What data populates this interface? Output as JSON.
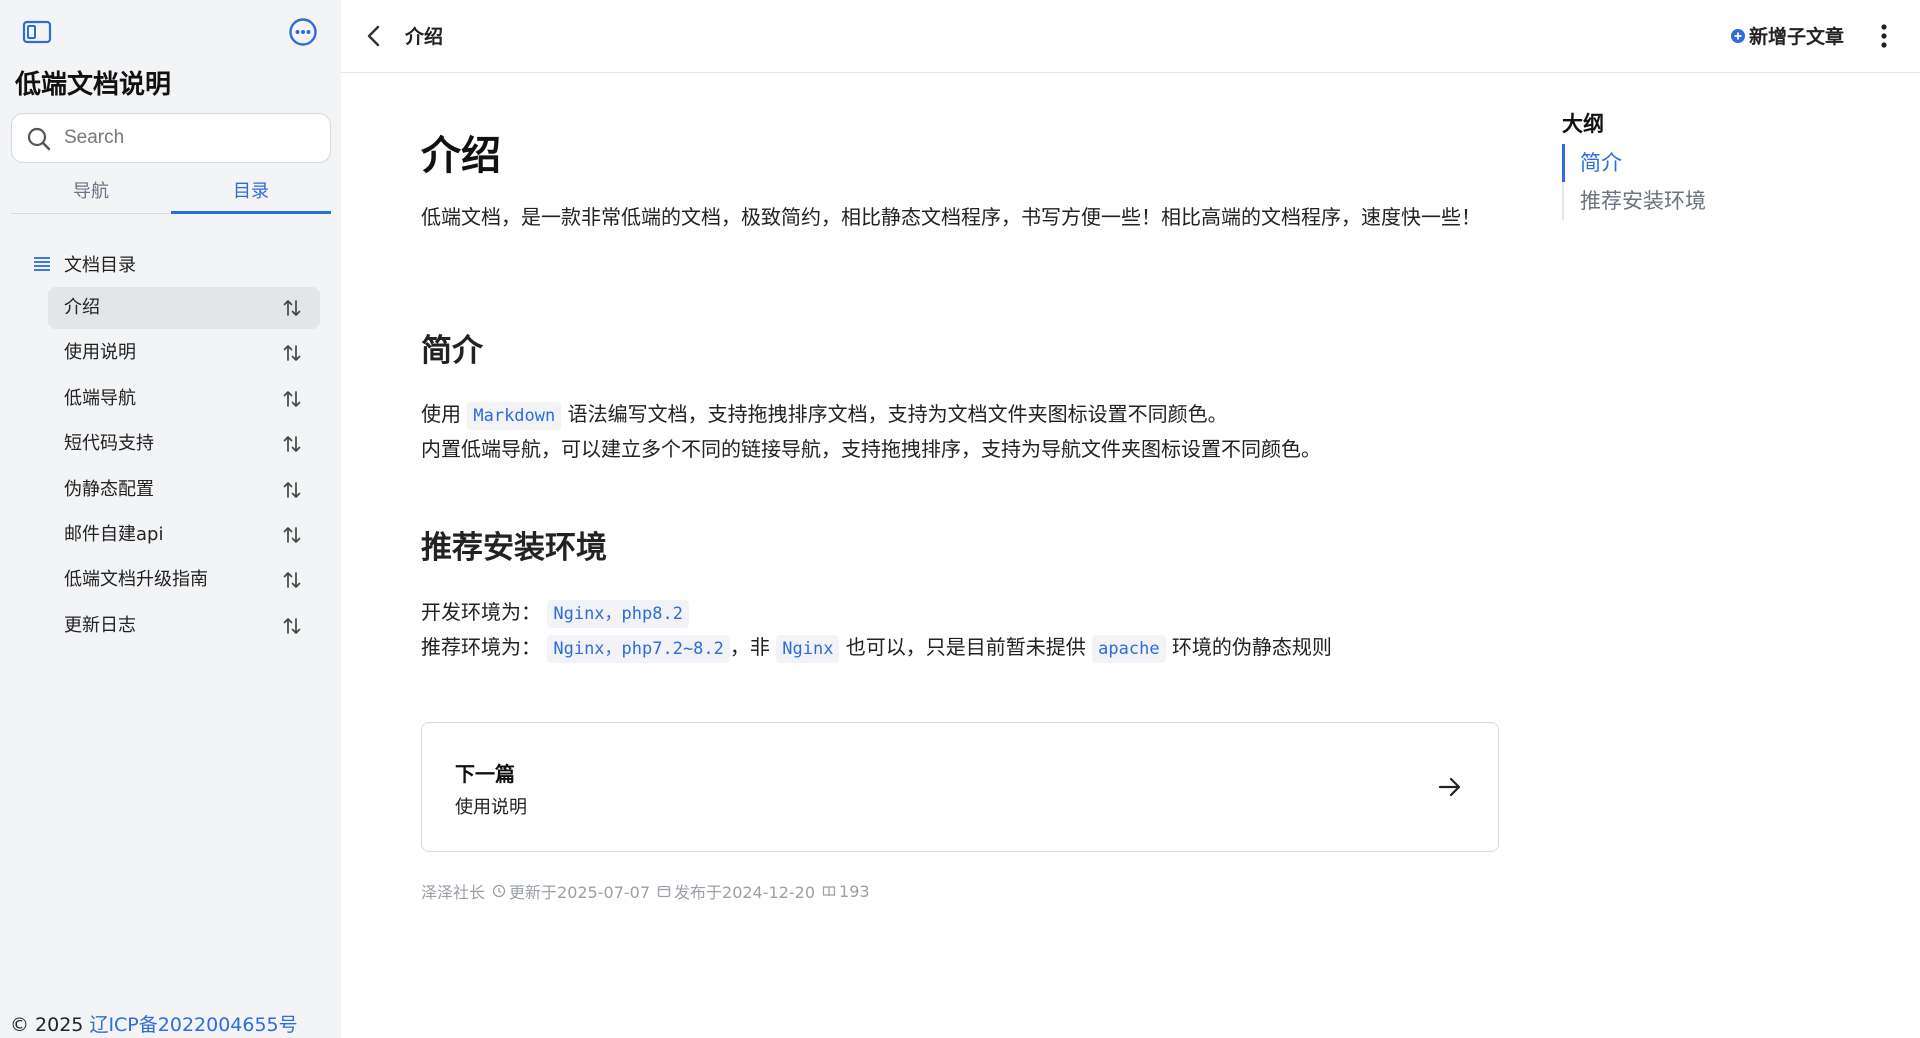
{
  "sidebar": {
    "title": "低端文档说明",
    "search_placeholder": "Search",
    "tabs": [
      {
        "label": "导航",
        "active": false
      },
      {
        "label": "目录",
        "active": true
      }
    ],
    "toc_heading": "文档目录",
    "items": [
      {
        "label": "介绍",
        "active": true
      },
      {
        "label": "使用说明",
        "active": false
      },
      {
        "label": "低端导航",
        "active": false
      },
      {
        "label": "短代码支持",
        "active": false
      },
      {
        "label": "伪静态配置",
        "active": false
      },
      {
        "label": "邮件自建api",
        "active": false
      },
      {
        "label": "低端文档升级指南",
        "active": false
      },
      {
        "label": "更新日志",
        "active": false
      }
    ],
    "footer_copyright": "© 2025 ",
    "footer_icp": "辽ICP备2022004655号"
  },
  "topbar": {
    "title": "介绍",
    "new_sub_article": "新增子文章"
  },
  "article": {
    "h1": "介绍",
    "intro": "低端文档，是一款非常低端的文档，极致简约，相比静态文档程序，书写方便一些！相比高端的文档程序，速度快一些！",
    "section1": {
      "heading": "简介",
      "l1_pre": "使用 ",
      "l1_code": "Markdown",
      "l1_post": " 语法编写文档，支持拖拽排序文档，支持为文档文件夹图标设置不同颜色。",
      "l2": "内置低端导航，可以建立多个不同的链接导航，支持拖拽排序，支持为导航文件夹图标设置不同颜色。"
    },
    "section2": {
      "heading": "推荐安装环境",
      "dev_label": "开发环境为：",
      "dev_code": "Nginx，php8.2",
      "rec_label": "推荐环境为：",
      "rec_code": "Nginx，php7.2~8.2",
      "rec_mid": "，非 ",
      "rec_code2": "Nginx",
      "rec_mid2": " 也可以，只是目前暂未提供 ",
      "rec_code3": "apache",
      "rec_end": " 环境的伪静态规则"
    },
    "next": {
      "label": "下一篇",
      "title": "使用说明"
    },
    "meta": {
      "author": "泽泽社长",
      "updated": "更新于2025-07-07",
      "published": "发布于2024-12-20",
      "views": "193"
    }
  },
  "outline": {
    "title": "大纲",
    "items": [
      {
        "label": "简介",
        "active": true
      },
      {
        "label": "推荐安装环境",
        "active": false
      }
    ]
  },
  "colors": {
    "accent": "#2f6bdc",
    "sidebar_bg": "#f3f4f6",
    "active_item_bg": "#e3e5e9",
    "code_bg": "#f1f3f6"
  },
  "icons": [
    "sidebar-toggle-icon",
    "more-icon",
    "search-icon",
    "list-icon",
    "sort-icon",
    "chevron-left-icon",
    "plus-circle-icon",
    "kebab-icon",
    "arrow-right-icon",
    "clock-icon",
    "calendar-icon",
    "book-icon"
  ]
}
